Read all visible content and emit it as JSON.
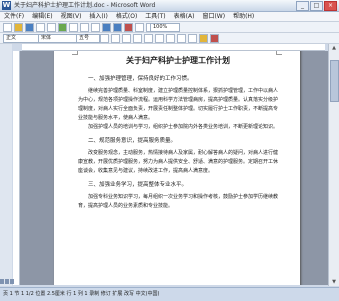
{
  "window": {
    "title": "关于妇产科护士护理工作计划.doc - Microsoft Word",
    "controls": [
      "_",
      "□",
      "×"
    ]
  },
  "menu": [
    "文件(F)",
    "编辑(E)",
    "视图(V)",
    "插入(I)",
    "格式(O)",
    "工具(T)",
    "表格(A)",
    "窗口(W)",
    "帮助(H)"
  ],
  "toolbar": {
    "style_value": "正文",
    "font_value": "宋体",
    "size_value": "五号",
    "zoom_value": "100%"
  },
  "document": {
    "title": "关于妇产科护士护理工作计划",
    "paragraphs": [
      {
        "kind": "heading",
        "text": "一、加强护理管理，保持良好的工作习惯。"
      },
      {
        "kind": "para",
        "text": "继续完善护理质量、科室制度，建立护理质量控制体系，狠抓护理管理，工作中以病人为中心，规范各项护理操作流程。运用科学方法管理病房，提高护理质量。认真落实分级护理制度，对病人实行全面负责，开展责任制整体护理。切实履行护士工作职责，不断提高专业技能与服务水平，使病人满意。"
      },
      {
        "kind": "para",
        "text": "加强护理人员的培训与学习，组织护士参加院内外各类业务培训，不断更新理论知识。"
      },
      {
        "kind": "heading",
        "text": "二、规范服务意识，提高服务质量。"
      },
      {
        "kind": "para",
        "text": "改变服务观念，主动服务，热情接待病人及家属，耐心解答病人的疑问，对病人进行健康宣教，开展优质护理服务，努力为病人提供安全、舒适、满意的护理服务。定期召开工休座谈会，收集意见与建议，持续改进工作，提高病人满意度。"
      },
      {
        "kind": "heading",
        "text": "三、加强业务学习，提高整体专业水平。"
      },
      {
        "kind": "para",
        "text": "加强专科业务知识学习，每月组织一次业务学习和操作考核，鼓励护士参加学历继续教育，提高护理人员的业务素质和专业技能。"
      }
    ]
  },
  "statusbar": {
    "text": "页 1  节 1  1/2  位置 2.5厘米  行 1  列 1  录制  修订  扩展  改写  中文(中国)"
  }
}
